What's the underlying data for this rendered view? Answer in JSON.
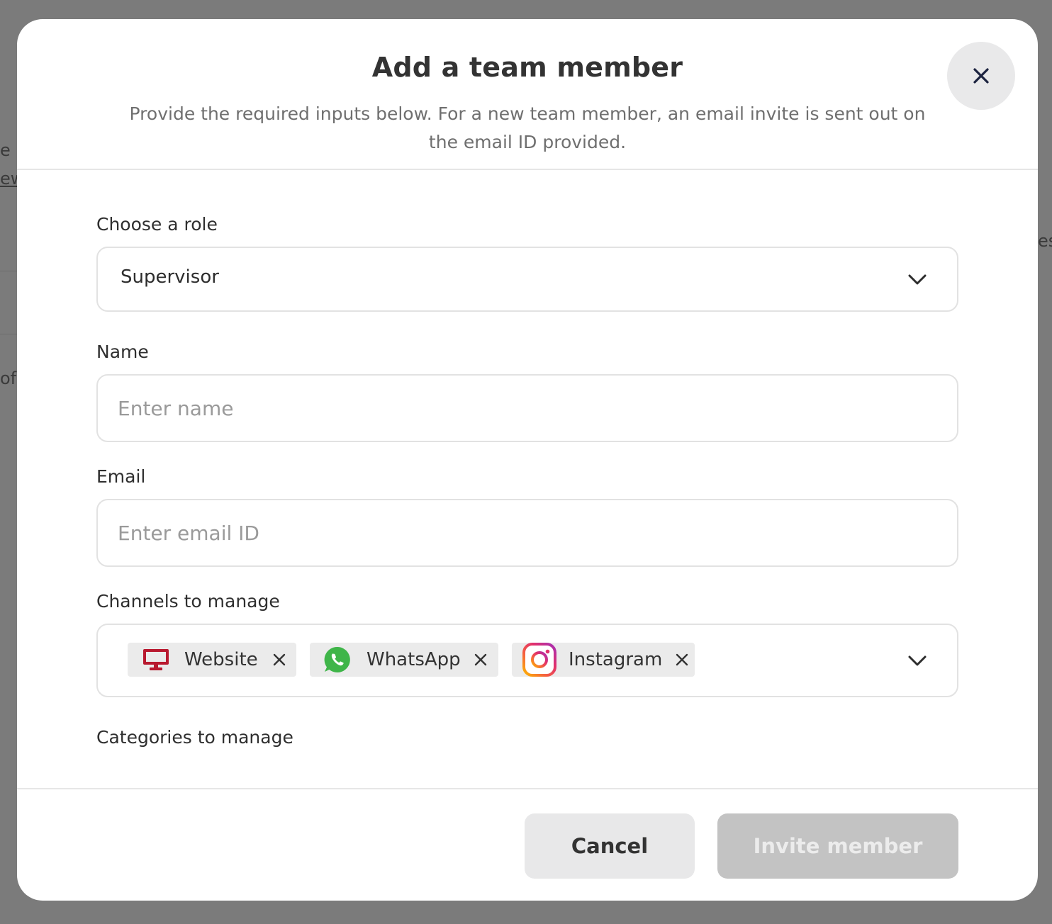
{
  "background": {
    "fragments": [
      "e",
      "ew",
      "of",
      "est"
    ]
  },
  "modal": {
    "title": "Add a team member",
    "subtitle": "Provide the required inputs below. For a new team member, an email invite is sent out on the email ID provided.",
    "close_icon": "close-icon"
  },
  "form": {
    "role": {
      "label": "Choose a role",
      "value": "Supervisor"
    },
    "name": {
      "label": "Name",
      "placeholder": "Enter name",
      "value": ""
    },
    "email": {
      "label": "Email",
      "placeholder": "Enter email ID",
      "value": ""
    },
    "channels": {
      "label": "Channels to manage",
      "selected": [
        {
          "label": "Website",
          "icon": "monitor-icon",
          "color": "#b8192f"
        },
        {
          "label": "WhatsApp",
          "icon": "whatsapp-icon",
          "color": "#3fb549"
        },
        {
          "label": "Instagram",
          "icon": "instagram-icon",
          "color": "#e1306c"
        }
      ]
    },
    "categories": {
      "label": "Categories to manage"
    }
  },
  "footer": {
    "cancel_label": "Cancel",
    "invite_label": "Invite member"
  }
}
